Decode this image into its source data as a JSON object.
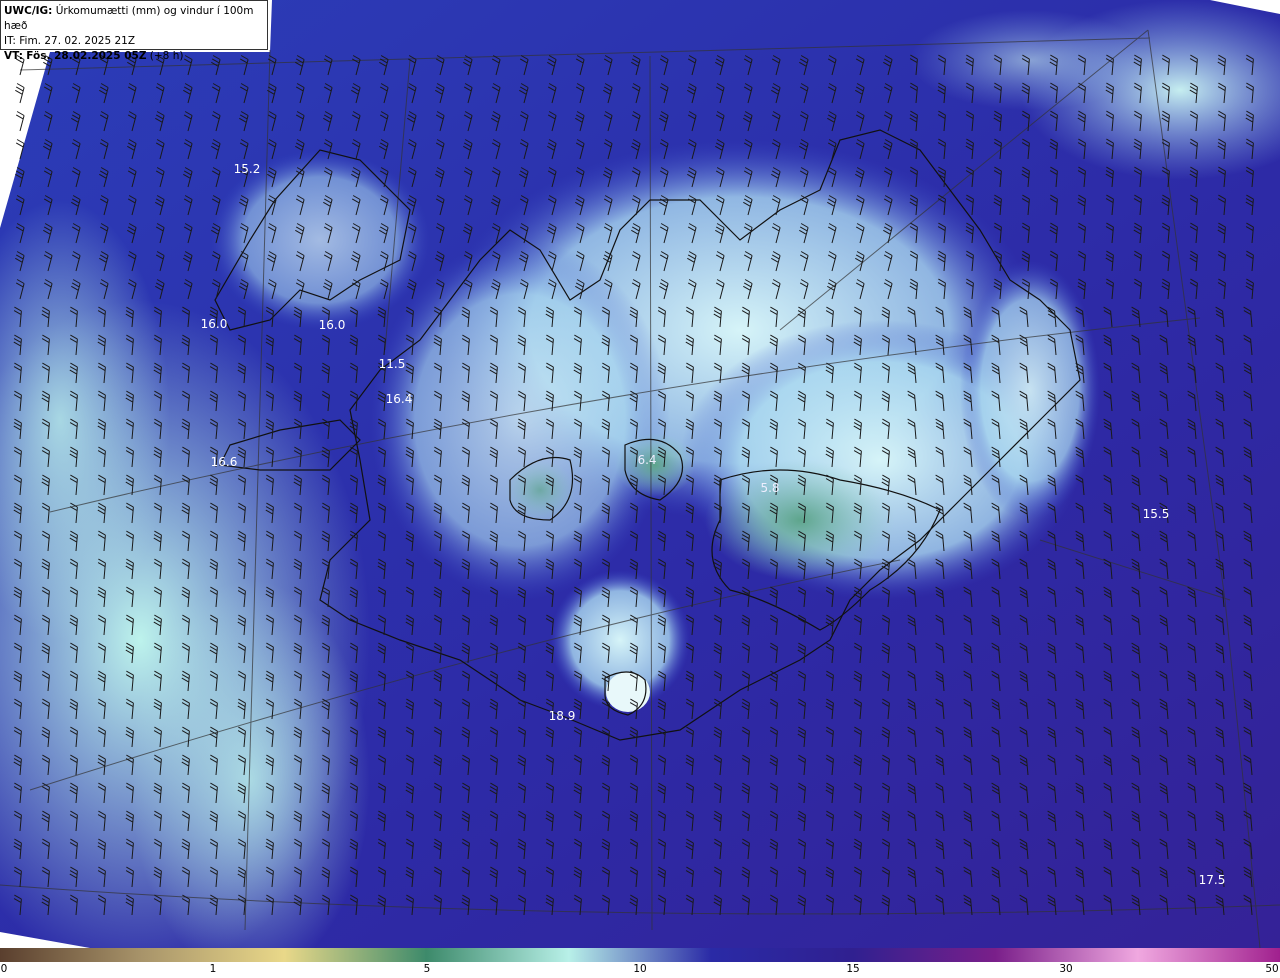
{
  "header": {
    "model": "UWC/IG:",
    "parameter": "Úrkomumætti (mm) og vindur í 100m hæð",
    "issue_prefix": "IT:",
    "issue_time": "Fim. 27. 02. 2025 21Z",
    "valid_prefix": "VT:",
    "valid_time": "Fös. 28.02.2025 05Z",
    "lead": "(+8 h)"
  },
  "map": {
    "values": [
      {
        "label": "15.2"
      },
      {
        "label": "16.0"
      },
      {
        "label": "16.0"
      },
      {
        "label": "11.5"
      },
      {
        "label": "16.4"
      },
      {
        "label": "16.6"
      },
      {
        "label": "6.4"
      },
      {
        "label": "5.8"
      },
      {
        "label": "15.5"
      },
      {
        "label": "18.9"
      },
      {
        "label": "17.5"
      }
    ]
  },
  "colorbar": {
    "ticks": [
      "0",
      "1",
      "5",
      "10",
      "15",
      "30",
      "50"
    ],
    "colors": [
      "#5a3f2e",
      "#a8946a",
      "#e9d889",
      "#3d8a6b",
      "#b8f0e8",
      "#2a2aa6",
      "#302090",
      "#7a1f8a",
      "#f0a8e0",
      "#a0208e"
    ]
  }
}
